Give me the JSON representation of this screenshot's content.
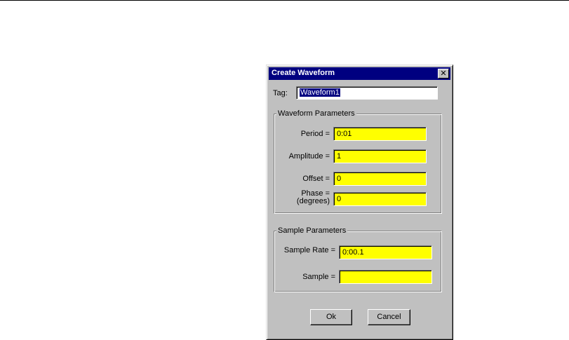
{
  "dialog": {
    "title": "Create Waveform",
    "close_glyph": "✕",
    "tag": {
      "label": "Tag:",
      "value": "Waveform1"
    },
    "waveform_params": {
      "legend": "Waveform Parameters",
      "period": {
        "label": "Period =",
        "value": "0:01"
      },
      "amplitude": {
        "label": "Amplitude =",
        "value": "1"
      },
      "offset": {
        "label": "Offset =",
        "value": "0"
      },
      "phase": {
        "label_line1": "Phase =",
        "label_line2": "(degrees)",
        "value": "0"
      }
    },
    "sample_params": {
      "legend": "Sample Parameters",
      "sample_rate": {
        "label": "Sample Rate =",
        "value": "0:00.1"
      },
      "sample": {
        "label": "Sample =",
        "value": ""
      }
    },
    "buttons": {
      "ok": "Ok",
      "cancel": "Cancel"
    }
  },
  "colors": {
    "field_background": "#ffff00",
    "title_bar": "#000080",
    "dialog_face": "#c0c0c0"
  }
}
